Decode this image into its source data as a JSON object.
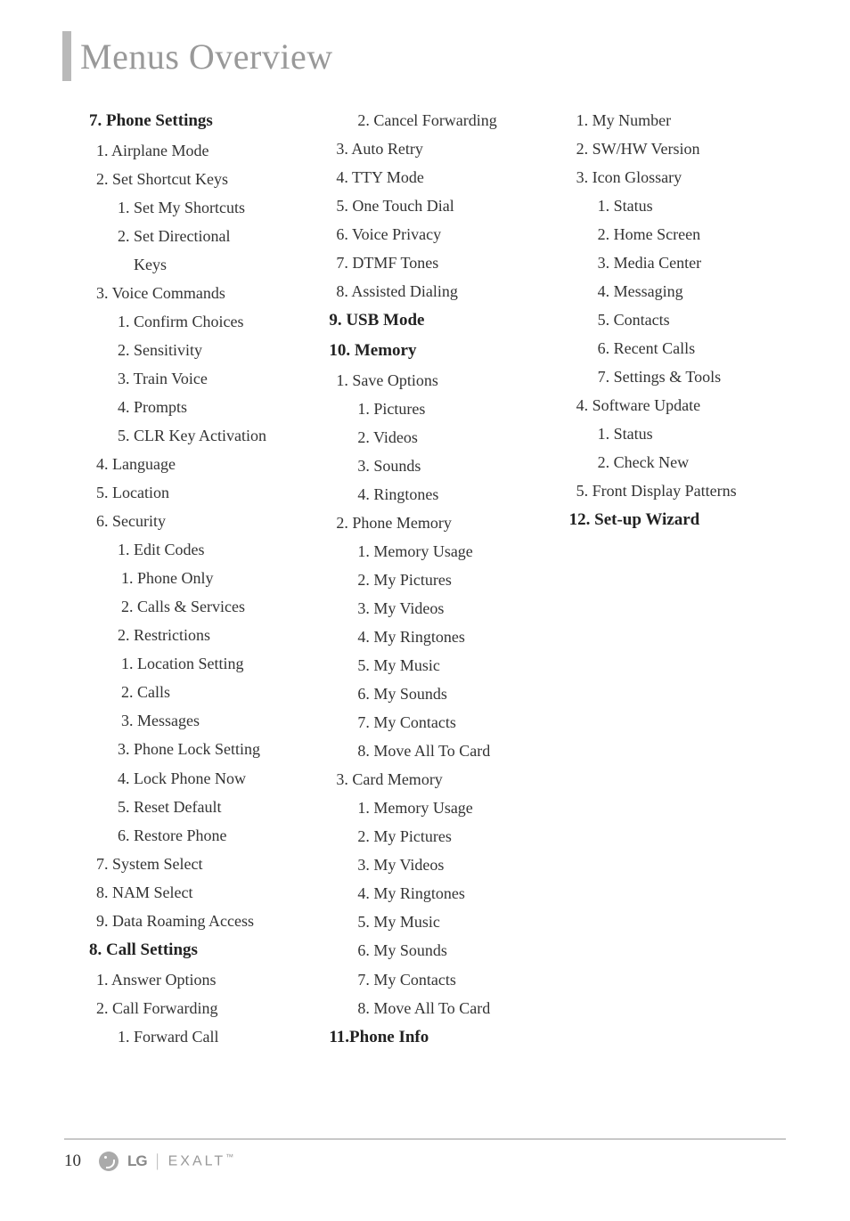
{
  "page_title": "Menus Overview",
  "page_number": "10",
  "brand_lg": "LG",
  "brand_exalt": "EXALT",
  "brand_tm": "™",
  "items": [
    {
      "cls": "h1",
      "t": "7. Phone Settings"
    },
    {
      "cls": "l1",
      "t": "1. Airplane Mode"
    },
    {
      "cls": "l1",
      "t": "2. Set Shortcut Keys"
    },
    {
      "cls": "l2",
      "t": "1. Set My Shortcuts"
    },
    {
      "cls": "l2-wrap",
      "t": "2. Set Directional"
    },
    {
      "cls": "l2-cont",
      "t": "Keys"
    },
    {
      "cls": "l1",
      "t": "3. Voice Commands"
    },
    {
      "cls": "l2",
      "t": "1. Confirm Choices"
    },
    {
      "cls": "l2",
      "t": "2. Sensitivity"
    },
    {
      "cls": "l2",
      "t": "3. Train Voice"
    },
    {
      "cls": "l2",
      "t": "4. Prompts"
    },
    {
      "cls": "l2",
      "t": "5. CLR Key Activation"
    },
    {
      "cls": "l1",
      "t": "4. Language"
    },
    {
      "cls": "l1",
      "t": "5. Location"
    },
    {
      "cls": "l1",
      "t": "6. Security"
    },
    {
      "cls": "l2",
      "t": "1. Edit Codes"
    },
    {
      "cls": "l3",
      "t": "1. Phone Only"
    },
    {
      "cls": "l3",
      "t": "2. Calls & Services"
    },
    {
      "cls": "l2",
      "t": "2. Restrictions"
    },
    {
      "cls": "l3",
      "t": "1. Location Setting"
    },
    {
      "cls": "l3",
      "t": "2. Calls"
    },
    {
      "cls": "l3",
      "t": "3. Messages"
    },
    {
      "cls": "l2",
      "t": "3. Phone Lock Setting"
    },
    {
      "cls": "l2",
      "t": "4. Lock Phone Now"
    },
    {
      "cls": "l2",
      "t": "5. Reset Default"
    },
    {
      "cls": "l2",
      "t": "6. Restore Phone"
    },
    {
      "cls": "l1",
      "t": "7. System Select"
    },
    {
      "cls": "l1",
      "t": "8. NAM Select"
    },
    {
      "cls": "l1",
      "t": "9. Data Roaming Access"
    },
    {
      "cls": "h1",
      "t": "8. Call Settings"
    },
    {
      "cls": "l1",
      "t": "1. Answer Options"
    },
    {
      "cls": "l1",
      "t": "2. Call Forwarding"
    },
    {
      "cls": "l2",
      "t": "1. Forward Call"
    },
    {
      "cls": "l2",
      "t": "2. Cancel Forwarding"
    },
    {
      "cls": "l1",
      "t": "3. Auto Retry"
    },
    {
      "cls": "l1",
      "t": "4. TTY Mode"
    },
    {
      "cls": "l1",
      "t": "5. One Touch Dial"
    },
    {
      "cls": "l1",
      "t": "6. Voice Privacy"
    },
    {
      "cls": "l1",
      "t": "7. DTMF Tones"
    },
    {
      "cls": "l1",
      "t": "8. Assisted Dialing"
    },
    {
      "cls": "h1",
      "t": "9. USB Mode"
    },
    {
      "cls": "h1",
      "t": "10. Memory"
    },
    {
      "cls": "l1",
      "t": "1. Save Options"
    },
    {
      "cls": "l2",
      "t": "1. Pictures"
    },
    {
      "cls": "l2",
      "t": "2. Videos"
    },
    {
      "cls": "l2",
      "t": "3. Sounds"
    },
    {
      "cls": "l2",
      "t": "4. Ringtones"
    },
    {
      "cls": "l1",
      "t": "2. Phone Memory"
    },
    {
      "cls": "l2",
      "t": "1. Memory Usage"
    },
    {
      "cls": "l2",
      "t": "2. My Pictures"
    },
    {
      "cls": "l2",
      "t": "3. My Videos"
    },
    {
      "cls": "l2",
      "t": "4. My Ringtones"
    },
    {
      "cls": "l2",
      "t": "5. My Music"
    },
    {
      "cls": "l2",
      "t": "6. My Sounds"
    },
    {
      "cls": "l2",
      "t": "7. My Contacts"
    },
    {
      "cls": "l2",
      "t": "8. Move All To Card"
    },
    {
      "cls": "l1",
      "t": "3. Card Memory"
    },
    {
      "cls": "l2",
      "t": "1. Memory Usage"
    },
    {
      "cls": "l2",
      "t": "2. My Pictures"
    },
    {
      "cls": "l2",
      "t": "3. My Videos"
    },
    {
      "cls": "l2",
      "t": "4. My Ringtones"
    },
    {
      "cls": "l2",
      "t": "5. My Music"
    },
    {
      "cls": "l2",
      "t": "6. My Sounds"
    },
    {
      "cls": "l2",
      "t": "7. My Contacts"
    },
    {
      "cls": "l2",
      "t": "8. Move All To Card"
    },
    {
      "cls": "h1-flush",
      "t": "11.Phone Info"
    },
    {
      "cls": "l1",
      "t": "1. My Number"
    },
    {
      "cls": "l1",
      "t": "2. SW/HW Version"
    },
    {
      "cls": "l1",
      "t": "3. Icon Glossary"
    },
    {
      "cls": "l2",
      "t": "1. Status"
    },
    {
      "cls": "l2",
      "t": "2. Home Screen"
    },
    {
      "cls": "l2",
      "t": "3. Media Center"
    },
    {
      "cls": "l2",
      "t": "4. Messaging"
    },
    {
      "cls": "l2",
      "t": "5. Contacts"
    },
    {
      "cls": "l2",
      "t": "6. Recent Calls"
    },
    {
      "cls": "l2",
      "t": "7. Settings & Tools"
    },
    {
      "cls": "l1",
      "t": "4. Software Update"
    },
    {
      "cls": "l2",
      "t": "1. Status"
    },
    {
      "cls": "l2",
      "t": "2. Check New"
    },
    {
      "cls": "l1",
      "t": "5. Front Display Patterns"
    },
    {
      "cls": "h1",
      "t": "12. Set-up Wizard"
    }
  ]
}
